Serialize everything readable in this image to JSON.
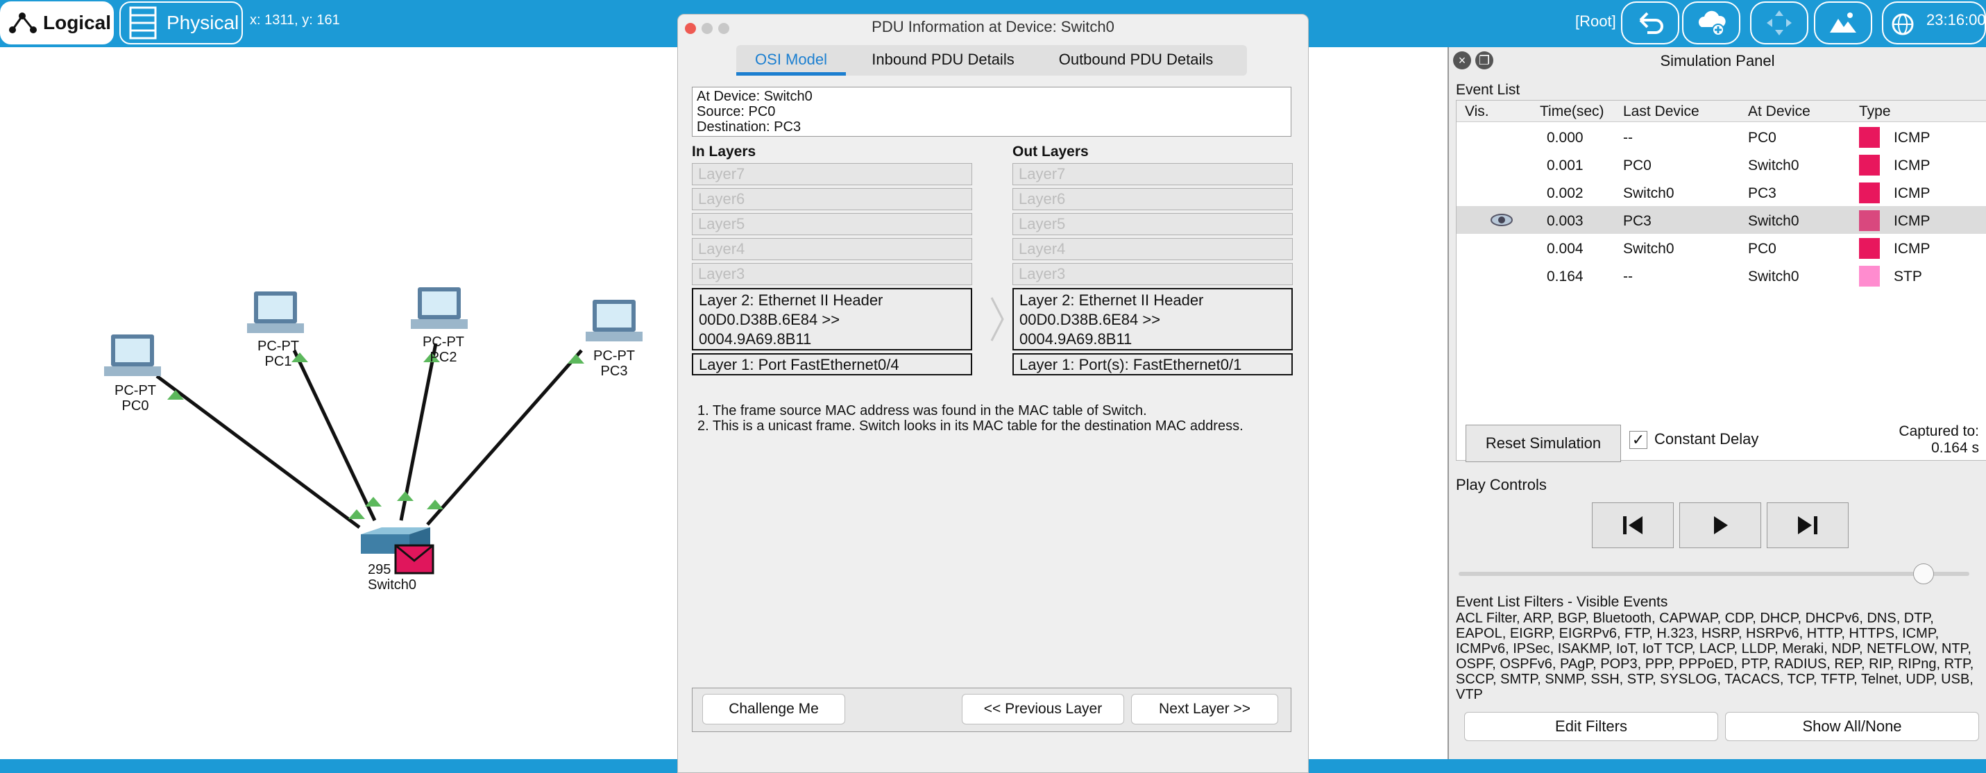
{
  "topbar": {
    "logical_label": "Logical",
    "physical_label": "Physical",
    "coords": "x: 1311, y: 161",
    "root_label": "[Root]",
    "clock": "23:16:00",
    "color": "#1c9ad6"
  },
  "topology": {
    "nodes": [
      {
        "type_label": "PC-PT",
        "name": "PC0"
      },
      {
        "type_label": "PC-PT",
        "name": "PC1"
      },
      {
        "type_label": "PC-PT",
        "name": "PC2"
      },
      {
        "type_label": "PC-PT",
        "name": "PC3"
      }
    ],
    "switch": {
      "model_label": "295",
      "name": "Switch0"
    },
    "link_color": "#111111",
    "link_status_color": "#5cb85c",
    "pdu_envelope_color": "#e0165c"
  },
  "pdu_window": {
    "title": "PDU Information at Device: Switch0",
    "tabs": [
      "OSI Model",
      "Inbound PDU Details",
      "Outbound PDU Details"
    ],
    "active_tab": "OSI Model",
    "info": [
      "At Device: Switch0",
      "Source: PC0",
      "Destination: PC3"
    ],
    "in_layers_label": "In Layers",
    "out_layers_label": "Out Layers",
    "in_layers": {
      "layer7": "Layer7",
      "layer6": "Layer6",
      "layer5": "Layer5",
      "layer4": "Layer4",
      "layer3": "Layer3",
      "layer2": [
        "Layer 2: Ethernet II Header",
        "00D0.D38B.6E84 >>",
        "0004.9A69.8B11"
      ],
      "layer1": "Layer 1: Port FastEthernet0/4"
    },
    "out_layers": {
      "layer7": "Layer7",
      "layer6": "Layer6",
      "layer5": "Layer5",
      "layer4": "Layer4",
      "layer3": "Layer3",
      "layer2": [
        "Layer 2: Ethernet II Header",
        "00D0.D38B.6E84 >>",
        "0004.9A69.8B11"
      ],
      "layer1": "Layer 1: Port(s): FastEthernet0/1"
    },
    "description": [
      "1. The frame source MAC address was found in the MAC table of Switch.",
      "2. This is a unicast frame. Switch looks in its MAC table for the destination MAC address."
    ],
    "buttons": {
      "challenge": "Challenge Me",
      "previous": "<< Previous Layer",
      "next": "Next Layer >>"
    }
  },
  "simulation_panel": {
    "title": "Simulation Panel",
    "event_list_label": "Event List",
    "columns": [
      "Vis.",
      "Time(sec)",
      "Last Device",
      "At Device",
      "Type"
    ],
    "events": [
      {
        "time": "0.000",
        "last": "--",
        "at": "PC0",
        "type": "ICMP",
        "color": "#e8175d",
        "selected": false,
        "visible_eye": false
      },
      {
        "time": "0.001",
        "last": "PC0",
        "at": "Switch0",
        "type": "ICMP",
        "color": "#e8175d",
        "selected": false,
        "visible_eye": false
      },
      {
        "time": "0.002",
        "last": "Switch0",
        "at": "PC3",
        "type": "ICMP",
        "color": "#e8175d",
        "selected": false,
        "visible_eye": false
      },
      {
        "time": "0.003",
        "last": "PC3",
        "at": "Switch0",
        "type": "ICMP",
        "color": "#d9487e",
        "selected": true,
        "visible_eye": true
      },
      {
        "time": "0.004",
        "last": "Switch0",
        "at": "PC0",
        "type": "ICMP",
        "color": "#e8175d",
        "selected": false,
        "visible_eye": false
      },
      {
        "time": "0.164",
        "last": "--",
        "at": "Switch0",
        "type": "STP",
        "color": "#ff8ccf",
        "selected": false,
        "visible_eye": false
      }
    ],
    "reset_label": "Reset Simulation",
    "constant_delay_label": "Constant Delay",
    "constant_delay_checked": "✓",
    "captured_label": "Captured to:",
    "captured_value": "0.164 s",
    "play_controls_label": "Play Controls",
    "speed_fraction": 0.91,
    "filters_title": "Event List Filters - Visible Events",
    "filters_text": "ACL Filter, ARP, BGP, Bluetooth, CAPWAP, CDP, DHCP, DHCPv6, DNS, DTP, EAPOL, EIGRP, EIGRPv6, FTP, H.323, HSRP, HSRPv6, HTTP, HTTPS, ICMP, ICMPv6, IPSec, ISAKMP, IoT, IoT TCP, LACP, LLDP, Meraki, NDP, NETFLOW, NTP, OSPF, OSPFv6, PAgP, POP3, PPP, PPPoED, PTP, RADIUS, REP, RIP, RIPng, RTP, SCCP, SMTP, SNMP, SSH, STP, SYSLOG, TACACS, TCP, TFTP, Telnet, UDP, USB, VTP",
    "edit_filters_label": "Edit Filters",
    "show_all_label": "Show All/None"
  }
}
